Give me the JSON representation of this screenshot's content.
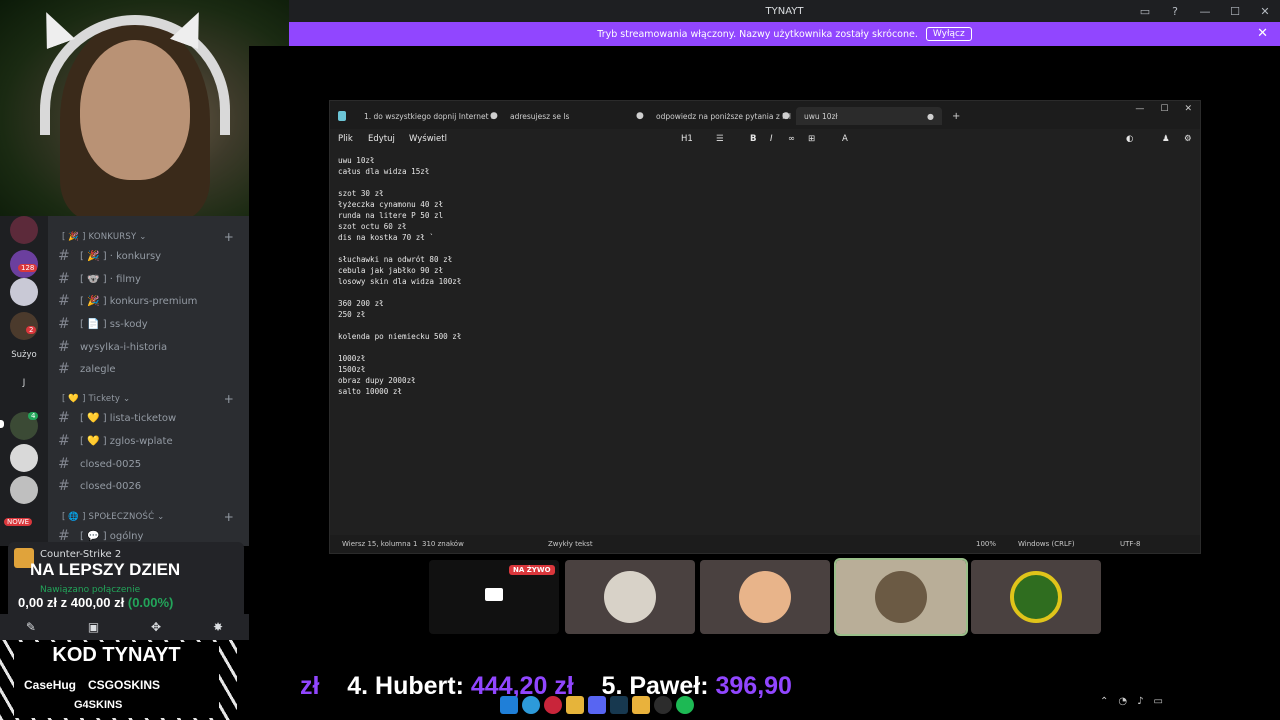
{
  "window": {
    "title": "TYNAYT"
  },
  "banner": {
    "text": "Tryb streamowania włączony. Nazwy użytkownika zostały skrócone.",
    "button": "Wyłącz"
  },
  "rail": {
    "servers": [
      {
        "name": "server-1"
      },
      {
        "name": "server-2",
        "badge": "128"
      },
      {
        "name": "server-3"
      },
      {
        "name": "server-4",
        "badge": "2"
      }
    ],
    "label_suzyo": "Sużyo",
    "label_j": "J",
    "badge_green": "4",
    "new_badge": "NOWE"
  },
  "channels": {
    "categories": {
      "konkursy": "[ 🎉 ] KONKURSY ⌄",
      "tickety": "[ 💛 ] Tickety ⌄",
      "spolecznosc": "[ 🌐 ] SPOŁECZNOŚĆ ⌄"
    },
    "items": [
      "[ 🎉 ]   · konkursy",
      "[ 🐨 ]   · filmy",
      "[ 🎉 ]  konkurs-premium",
      "[ 📄 ]  ss-kody",
      "wysylka-i-historia",
      "zalegle",
      "[ 💛 ]  lista-ticketow",
      "[ 💛 ]  zglos-wplate",
      "closed-0025",
      "closed-0026",
      "[ 💬 ]  ogólny"
    ]
  },
  "activity": {
    "game": "Counter-Strike 2",
    "overlay_text": "NA LEPSZY DZIEN",
    "connection": "Nawiązano połączenie",
    "amount": "0,00 zł z 400,00 zł",
    "percent": "(0.00%)"
  },
  "promo": {
    "title": "KOD TYNAYT",
    "sponsors": [
      "CaseHug",
      "CSGOSKINS"
    ],
    "sponsor2": "G4SKINS"
  },
  "notepad": {
    "tabs": [
      "1. do wszystkiego dopnij Internet i",
      "adresujesz se ls",
      "odpowiedz na poniższe pytania z lel",
      "uwu 10zł"
    ],
    "menu": [
      "Plik",
      "Edytuj",
      "Wyświetl"
    ],
    "format": "H1",
    "lines": [
      "uwu 10zł",
      "całus dla widza 15zł",
      "",
      "szot 30 zł",
      "łyżeczka cynamonu 40 zł",
      "runda na litere P 50 zl",
      "szot octu 60 zł",
      "dis na kostka 70 zł `",
      "",
      "słuchawki na odwrót 80 zł",
      "cebula jak jabłko 90 zł",
      "losowy skin dla widza 100zł",
      "",
      "360 200 zł",
      "250 zł",
      "",
      "kolenda po niemiecku 500 zł",
      "",
      "1000zł",
      "1500zł",
      "obraz dupy 2000zł",
      "salto 10000 zł"
    ],
    "status": {
      "position": "Wiersz 15, kolumna 1",
      "chars": "310 znaków",
      "type": "Zwykły tekst",
      "zoom": "100%",
      "eol": "Windows (CRLF)",
      "encoding": "UTF-8"
    }
  },
  "call": {
    "live_label": "NA ŻYWO"
  },
  "ticker": {
    "prefix": "zł",
    "rank4_name": "4. Hubert:",
    "rank4_value": "444,20 zł",
    "rank5_name": "5. Paweł:",
    "rank5_value": "396,90"
  }
}
